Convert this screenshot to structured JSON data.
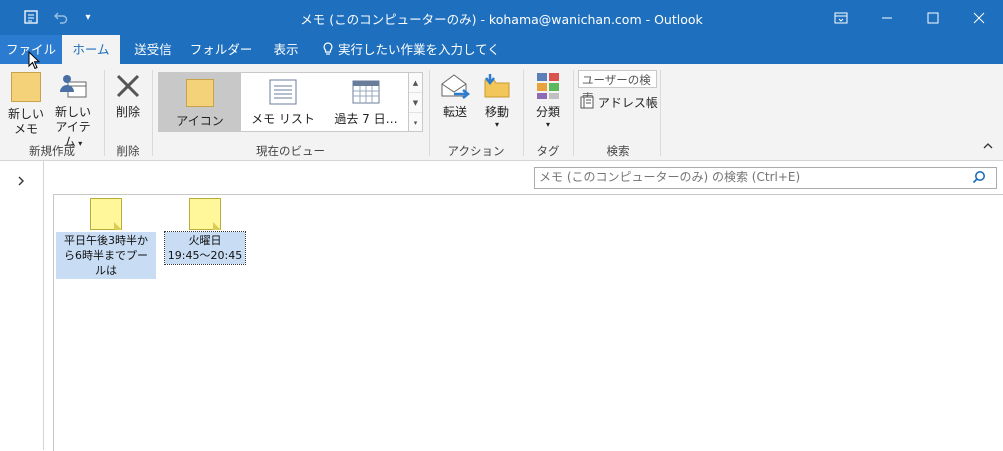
{
  "window": {
    "title": "メモ (このコンピューターのみ) - kohama@wanichan.com - Outlook"
  },
  "tabs": [
    {
      "label": "ファイル"
    },
    {
      "label": "ホーム"
    },
    {
      "label": "送受信"
    },
    {
      "label": "フォルダー"
    },
    {
      "label": "表示"
    }
  ],
  "tell_me": "実行したい作業を入力してください",
  "ribbon": {
    "new": {
      "label_l1": "新しい",
      "label_l2": "メモ",
      "group": "新規作成"
    },
    "new_item": {
      "label_l1": "新しい",
      "label_l2": "アイテム"
    },
    "delete": {
      "label": "削除",
      "group": "削除"
    },
    "view": {
      "items": [
        {
          "label": "アイコン"
        },
        {
          "label": "メモ リスト"
        },
        {
          "label": "過去 7 日…"
        }
      ],
      "group": "現在のビュー"
    },
    "forward": {
      "label": "転送"
    },
    "move": {
      "label": "移動"
    },
    "actions_group": "アクション",
    "categorize": {
      "label": "分類"
    },
    "tags_group": "タグ",
    "search_people": "ユーザーの検索",
    "address_book": "アドレス帳",
    "search_group": "検索"
  },
  "search": {
    "placeholder": "メモ (このコンピューターのみ) の検索 (Ctrl+E)"
  },
  "notes": [
    {
      "line1": "平日午後3時半か",
      "line2": "ら6時半までプールは"
    },
    {
      "line1": "火曜日",
      "line2": "19:45～20:45"
    }
  ],
  "colors": {
    "title_blue": "#1e6fbd",
    "ribbon_bg": "#f3f3f3",
    "note_yellow": "#fff799",
    "selection": "#c8dcf4"
  }
}
